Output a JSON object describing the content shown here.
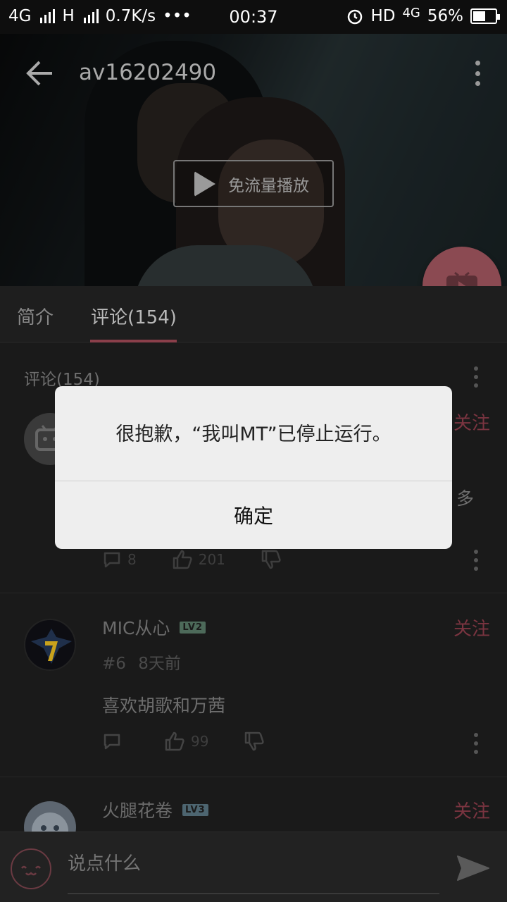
{
  "status_bar": {
    "network1": "4G",
    "network2": "H",
    "speed": "0.7K/s",
    "dots": "•••",
    "time": "00:37",
    "hd": "HD",
    "network3": "4G",
    "battery": "56%",
    "battery_level": 0.56
  },
  "video": {
    "title": "av16202490",
    "free_play_label": "免流量播放"
  },
  "tabs": [
    {
      "label": "简介"
    },
    {
      "label": "评论(154)"
    }
  ],
  "comments_section": {
    "title": "评论(154)"
  },
  "comments": [
    {
      "partial_text": "多",
      "follow_label": "关注",
      "replies": "8",
      "likes": "201"
    },
    {
      "username": "MIC从心",
      "level": "LV2",
      "floor": "#6",
      "time": "8天前",
      "text": "喜欢胡歌和万茜",
      "follow_label": "关注",
      "likes": "99"
    },
    {
      "username": "火腿花卷",
      "level": "LV3",
      "follow_label": "关注"
    }
  ],
  "input": {
    "placeholder": "说点什么"
  },
  "dialog": {
    "message": "很抱歉，“我叫MT”已停止运行。",
    "confirm_label": "确定"
  },
  "colors": {
    "accent": "#fb7299",
    "dimmed_accent": "#7a3440",
    "dialog_bg": "#eeeeee"
  }
}
